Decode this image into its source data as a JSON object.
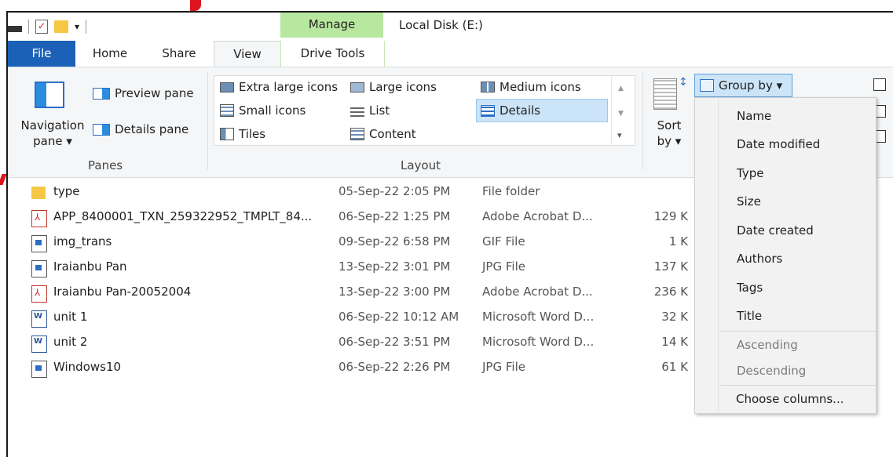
{
  "window": {
    "title": "Local Disk (E:)"
  },
  "ribbon_tabs": {
    "file": "File",
    "home": "Home",
    "share": "Share",
    "view": "View",
    "context_band": "Manage",
    "drive_tools": "Drive Tools"
  },
  "panes": {
    "navigation_pane": "Navigation",
    "navigation_pane_2": "pane ▾",
    "preview_pane": "Preview pane",
    "details_pane": "Details pane",
    "group_label": "Panes"
  },
  "layout": {
    "extra_large_icons": "Extra large icons",
    "large_icons": "Large icons",
    "medium_icons": "Medium icons",
    "small_icons": "Small icons",
    "list": "List",
    "details": "Details",
    "tiles": "Tiles",
    "content": "Content",
    "group_label": "Layout",
    "selected": "Details"
  },
  "current_view": {
    "sort_by": "Sort",
    "sort_by_2": "by ▾",
    "group_by": "Group by ▾"
  },
  "files": [
    {
      "name": "type",
      "date": "05-Sep-22 2:05 PM",
      "type": "File folder",
      "size": "",
      "icon": "folder-icon"
    },
    {
      "name": "APP_8400001_TXN_259322952_TMPLT_84...",
      "date": "06-Sep-22 1:25 PM",
      "type": "Adobe Acrobat D...",
      "size": "129 K",
      "icon": "pdf-icon"
    },
    {
      "name": "img_trans",
      "date": "09-Sep-22 6:58 PM",
      "type": "GIF File",
      "size": "1 K",
      "icon": "image-icon"
    },
    {
      "name": "Iraianbu Pan",
      "date": "13-Sep-22 3:01 PM",
      "type": "JPG File",
      "size": "137 K",
      "icon": "image-icon"
    },
    {
      "name": "Iraianbu Pan-20052004",
      "date": "13-Sep-22 3:00 PM",
      "type": "Adobe Acrobat D...",
      "size": "236 K",
      "icon": "pdf-icon"
    },
    {
      "name": "unit 1",
      "date": "06-Sep-22 10:12 AM",
      "type": "Microsoft Word D...",
      "size": "32 K",
      "icon": "word-icon"
    },
    {
      "name": "unit 2",
      "date": "06-Sep-22 3:51 PM",
      "type": "Microsoft Word D...",
      "size": "14 K",
      "icon": "word-icon"
    },
    {
      "name": "Windows10",
      "date": "06-Sep-22 2:26 PM",
      "type": "JPG File",
      "size": "61 K",
      "icon": "image-icon"
    }
  ],
  "group_by_menu": {
    "items": [
      "Name",
      "Date modified",
      "Type",
      "Size",
      "Date created",
      "Authors",
      "Tags",
      "Title"
    ],
    "order_items": [
      "Ascending",
      "Descending"
    ],
    "choose_columns": "Choose columns..."
  },
  "colors": {
    "file_tab": "#1c61b8",
    "manage_band": "#b8e89f",
    "selection": "#cce4f7",
    "accent_mark": "#e0141c"
  }
}
